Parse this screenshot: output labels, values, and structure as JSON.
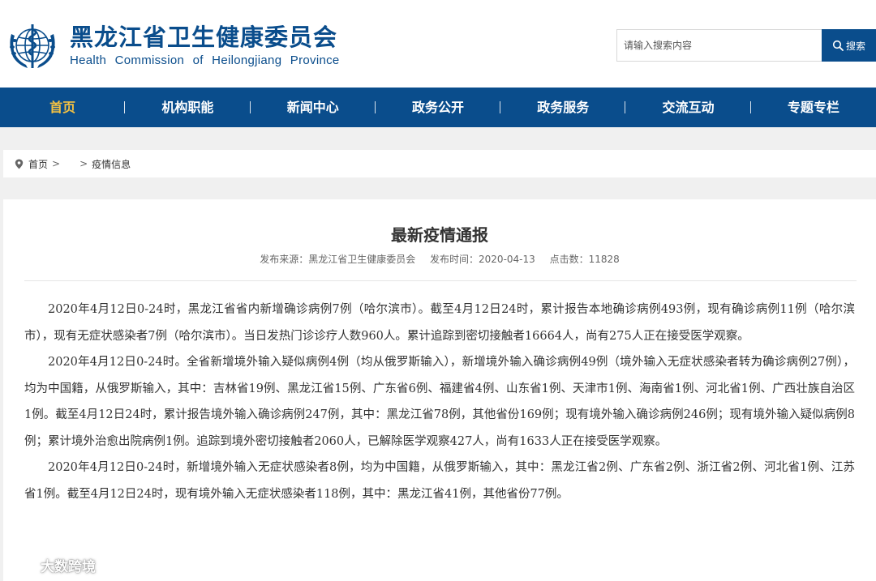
{
  "header": {
    "site_name_cn": "黑龙江省卫生健康委员会",
    "site_name_en": "Health Commission of Heilongjiang Province",
    "search": {
      "placeholder": "请输入搜索内容",
      "button_label": "搜索"
    }
  },
  "nav": {
    "items": [
      {
        "label": "首页",
        "active": true
      },
      {
        "label": "机构职能"
      },
      {
        "label": "新闻中心"
      },
      {
        "label": "政务公开"
      },
      {
        "label": "政务服务"
      },
      {
        "label": "交流互动"
      },
      {
        "label": "专题专栏"
      }
    ]
  },
  "breadcrumb": {
    "home": "首页",
    "separator_1": ">",
    "separator_2": ">",
    "current": "疫情信息"
  },
  "article": {
    "title": "最新疫情通报",
    "source": "发布来源：黑龙江省卫生健康委员会",
    "date": "发布时间：2020-04-13",
    "hits": "点击数：11828",
    "paragraphs": [
      "2020年4月12日0-24时，黑龙江省省内新增确诊病例7例（哈尔滨市）。截至4月12日24时，累计报告本地确诊病例493例，现有确诊病例11例（哈尔滨市），现有无症状感染者7例（哈尔滨市）。当日发热门诊诊疗人数960人。累计追踪到密切接触者16664人，尚有275人正在接受医学观察。",
      "2020年4月12日0-24时。全省新增境外输入疑似病例4例（均从俄罗斯输入），新增境外输入确诊病例49例（境外输入无症状感染者转为确诊病例27例），均为中国籍，从俄罗斯输入，其中：吉林省19例、黑龙江省15例、广东省6例、福建省4例、山东省1例、天津市1例、海南省1例、河北省1例、广西壮族自治区1例。截至4月12日24时，累计报告境外输入确诊病例247例，其中：黑龙江省78例，其他省份169例；现有境外输入确诊病例246例；现有境外输入疑似病例8例；累计境外治愈出院病例1例。追踪到境外密切接触者2060人，已解除医学观察427人，尚有1633人正在接受医学观察。",
      "2020年4月12日0-24时，新增境外输入无症状感染者8例，均为中国籍，从俄罗斯输入，其中：黑龙江省2例、广东省2例、浙江省2例、河北省1例、江苏省1例。截至4月12日24时，现有境外输入无症状感染者118例，其中：黑龙江省41例，其他省份77例。"
    ]
  },
  "watermark": {
    "text": "大数跨境"
  },
  "colors": {
    "brand_blue": "#0a4d8c",
    "nav_active": "#f5c242",
    "page_bg": "#f0f0f0"
  },
  "icons": {
    "logo": "who-emblem-icon",
    "search": "search-icon",
    "location": "location-pin-icon",
    "watermark": "watermark-logo-icon"
  }
}
